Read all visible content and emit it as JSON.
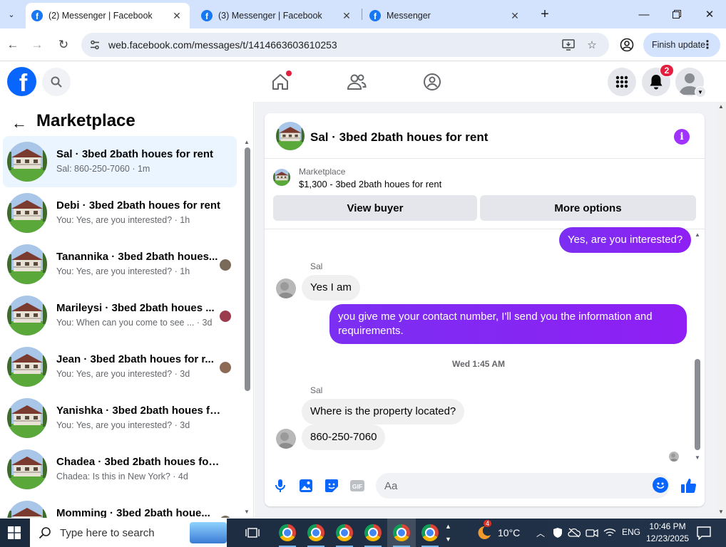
{
  "browser": {
    "tabs": [
      {
        "title": "(2) Messenger | Facebook",
        "active": true
      },
      {
        "title": "(3) Messenger | Facebook",
        "active": false
      },
      {
        "title": "Messenger",
        "active": false
      }
    ],
    "url": "web.facebook.com/messages/t/1414663603610253",
    "finish_update_label": "Finish update"
  },
  "fb_header": {
    "notification_count": "2",
    "icons": [
      "facebook-logo",
      "search-icon",
      "home-icon",
      "friends-icon",
      "groups-icon",
      "menu-grid-icon",
      "bell-icon",
      "avatar"
    ]
  },
  "left_pane": {
    "title": "Marketplace",
    "conversations": [
      {
        "name": "Sal · 3bed 2bath houes for rent",
        "preview": "Sal: 860-250-7060 · 1m",
        "selected": true
      },
      {
        "name": "Debi · 3bed 2bath houes for rent",
        "preview": "You: Yes, are you interested? · 1h"
      },
      {
        "name": "Tanannika · 3bed 2bath houes...",
        "preview": "You: Yes, are you interested? · 1h"
      },
      {
        "name": "Marileysi · 3bed 2bath houes ...",
        "preview": "You: When can you come to see ... · 3d"
      },
      {
        "name": "Jean · 3bed 2bath houes for r...",
        "preview": "You: Yes, are you interested? · 3d"
      },
      {
        "name": "Yanishka · 3bed 2bath houes for...",
        "preview": "You: Yes, are you interested? · 3d"
      },
      {
        "name": "Chadea · 3bed 2bath houes for r...",
        "preview": "Chadea: Is this in New York? · 4d"
      },
      {
        "name": "Momming · 3bed 2bath houe...",
        "preview": ""
      }
    ]
  },
  "chat": {
    "title": "Sal · 3bed 2bath houes for rent",
    "listing": {
      "label": "Marketplace",
      "price_title": "$1,300 - 3bed 2bath houes for rent"
    },
    "buttons": {
      "view_buyer": "View buyer",
      "more_options": "More options"
    },
    "messages": [
      {
        "from": "me",
        "text": "Yes, are you interested?"
      },
      {
        "sender": "Sal",
        "from": "them",
        "text": "Yes I am"
      },
      {
        "from": "me",
        "text": "you give me your contact number, I'll send you the information and requirements."
      },
      {
        "timestamp": "Wed 1:45 AM"
      },
      {
        "sender": "Sal",
        "from": "them",
        "text": "Where is the property located?"
      },
      {
        "from": "them",
        "text": "860-250-7060"
      }
    ],
    "composer_placeholder": "Aa",
    "accent": "#8a1cf0"
  },
  "taskbar": {
    "search_placeholder": "Type here to search",
    "weather_badge": "4",
    "temperature": "10°C",
    "language": "ENG",
    "time": "10:46 PM",
    "date": "12/23/2025"
  }
}
